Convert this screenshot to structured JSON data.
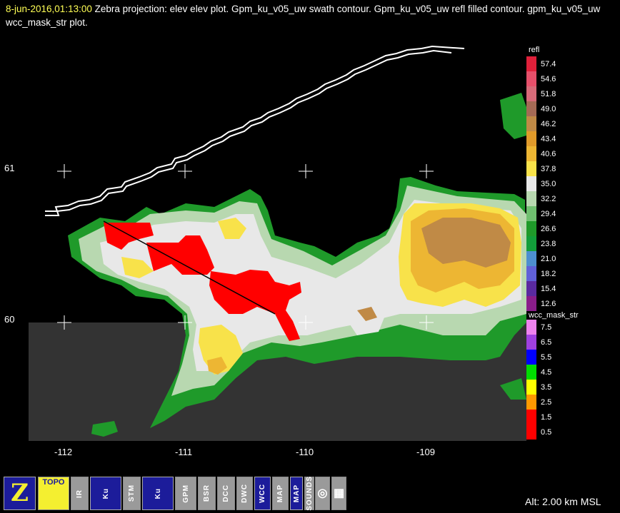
{
  "title": {
    "date": "8-jun-2016,01:13:00",
    "text": "  Zebra projection: elev elev  plot.  Gpm_ku_v05_uw swath contour.  Gpm_ku_v05_uw refl filled contour.  gpm_ku_v05_uw wcc_mask_str  plot."
  },
  "axes": {
    "lat_labels": [
      "61",
      "60"
    ],
    "lon_labels": [
      "-112",
      "-111",
      "-110",
      "-109"
    ]
  },
  "colorbars": {
    "refl": {
      "title": "refl",
      "values": [
        "57.4",
        "54.6",
        "51.8",
        "49.0",
        "46.2",
        "43.4",
        "40.6",
        "37.8",
        "35.0",
        "32.2",
        "29.4",
        "26.6",
        "23.8",
        "21.0",
        "18.2",
        "15.4",
        "12.6"
      ],
      "colors": [
        "#e0203a",
        "#e64f6a",
        "#d66a78",
        "#a56a55",
        "#c08a46",
        "#e09a2a",
        "#edb633",
        "#f8e24a",
        "#e8e8e8",
        "#b8d8b0",
        "#70c070",
        "#1f9a2a",
        "#129e3a",
        "#4d8fd0",
        "#6060d8",
        "#5a2aa0",
        "#8a1d8a"
      ]
    },
    "wcc": {
      "title": "wcc_mask_str",
      "values": [
        "7.5",
        "6.5",
        "5.5",
        "4.5",
        "3.5",
        "2.5",
        "1.5",
        "0.5"
      ],
      "colors": [
        "#ee82ee",
        "#a040e0",
        "#0000ff",
        "#00dd00",
        "#ffff00",
        "#ff9900",
        "#ff0000",
        "#ff0000"
      ]
    }
  },
  "toolbar": {
    "buttons": [
      {
        "label": "Z",
        "icon": "zebra-logo-icon"
      },
      {
        "label": "TOPO",
        "icon": "topo-icon"
      },
      {
        "label": "IR",
        "icon": "ir-icon"
      },
      {
        "label": "Ku",
        "icon": "ku-icon"
      },
      {
        "label": "STM",
        "icon": "stm-icon"
      },
      {
        "label": "Ku",
        "icon": "ku-gpm-icon"
      },
      {
        "label": "GPM",
        "icon": "gpm-sf-icon"
      },
      {
        "label": "BSR",
        "icon": "bsr-icon"
      },
      {
        "label": "DCC",
        "icon": "dcc-icon"
      },
      {
        "label": "DWC",
        "icon": "dwc-icon"
      },
      {
        "label": "WCC",
        "icon": "wcc-icon"
      },
      {
        "label": "MAP",
        "icon": "map-us-icon"
      },
      {
        "label": "MAP",
        "icon": "map-icon"
      },
      {
        "label": "SOUNDS",
        "icon": "sounds-icon"
      },
      {
        "label": "",
        "icon": "target-icon"
      },
      {
        "label": "",
        "icon": "grid-icon"
      }
    ]
  },
  "altitude": "Alt: 2.00 km MSL"
}
